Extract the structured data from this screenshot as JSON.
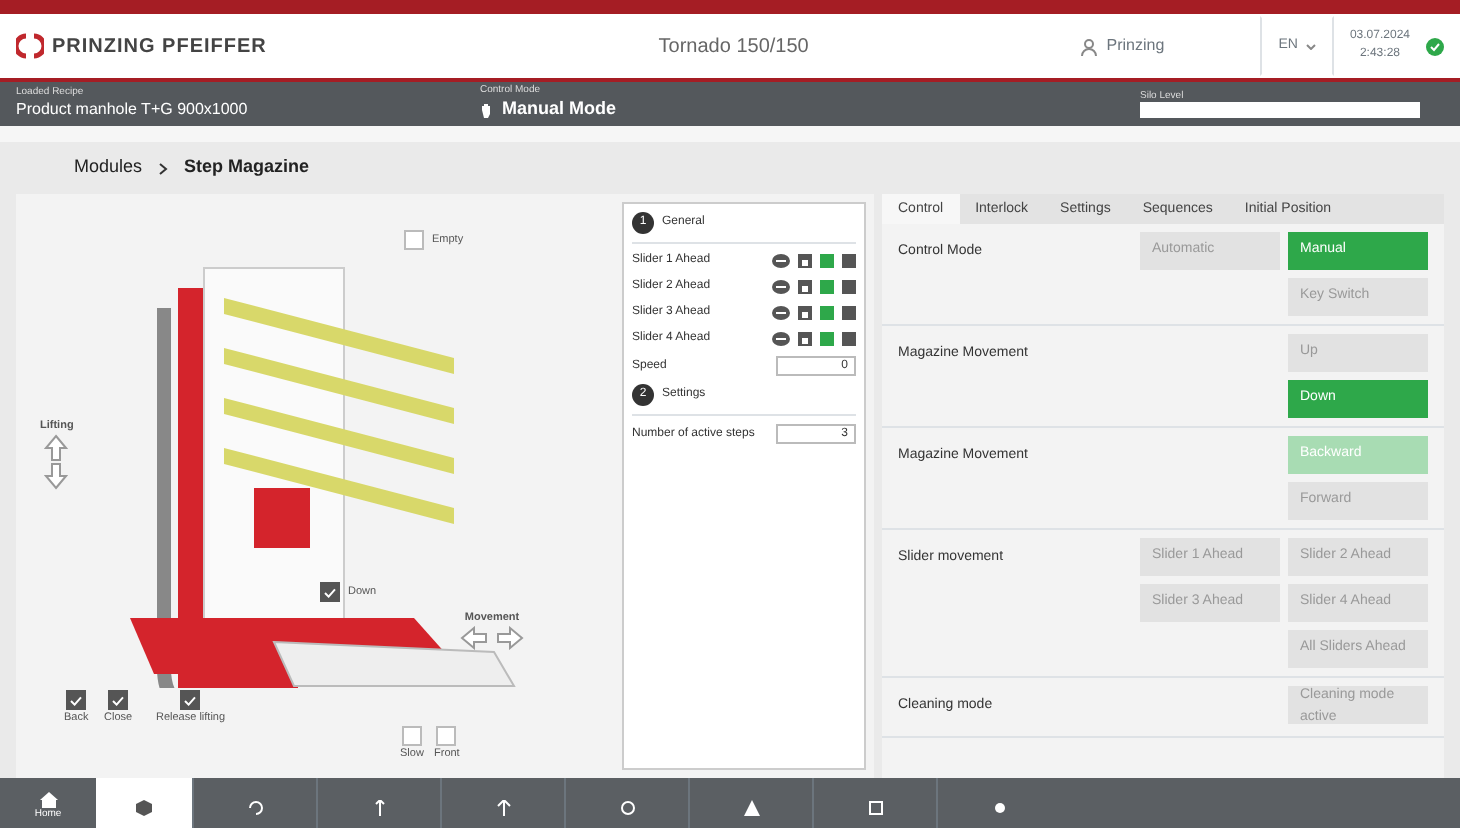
{
  "header": {
    "brand": "PRINZING PFEIFFER",
    "machine": "Tornado 150/150",
    "user": "Prinzing",
    "language": "EN",
    "date": "03.07.2024",
    "time": "2:43:28"
  },
  "info_bar": {
    "recipe_label": "Loaded Recipe",
    "recipe": "Product manhole T+G 900x1000",
    "mode_label": "Control Mode",
    "mode": "Manual Mode",
    "silo_label": "Silo Level"
  },
  "breadcrumb": [
    {
      "label": "Modules"
    },
    {
      "label": "Step Magazine"
    }
  ],
  "diagram": {
    "kind": "picture",
    "lifting_label": "Lifting",
    "movement_label": "Movement",
    "checks": [
      {
        "label": "Empty",
        "checked": false
      },
      {
        "label": "Down",
        "checked": true
      },
      {
        "label": "Back",
        "checked": true
      },
      {
        "label": "Close",
        "checked": true
      },
      {
        "label": "Release lifting",
        "checked": true
      },
      {
        "label": "Slow",
        "checked": false
      },
      {
        "label": "Front",
        "checked": false
      }
    ]
  },
  "general": {
    "number": "1",
    "title": "General",
    "sliders": [
      {
        "label": "Slider 1 Ahead"
      },
      {
        "label": "Slider 2 Ahead"
      },
      {
        "label": "Slider 3 Ahead"
      },
      {
        "label": "Slider 4 Ahead"
      }
    ],
    "speed_label": "Speed",
    "speed": "0"
  },
  "settings": {
    "number": "2",
    "title": "Settings",
    "steps_label": "Number of active steps",
    "steps": "3"
  },
  "tabs": [
    {
      "label": "Control",
      "selected": true
    },
    {
      "label": "Interlock",
      "selected": false
    },
    {
      "label": "Settings",
      "selected": false
    },
    {
      "label": "Sequences",
      "selected": false
    },
    {
      "label": "Initial Position",
      "selected": false
    }
  ],
  "controls": [
    {
      "label": "Control Mode",
      "buttons": [
        {
          "label": "Automatic",
          "selected": false,
          "pending": false
        },
        {
          "label": "Manual",
          "selected": true,
          "pending": false
        },
        {
          "label": "Key Switch",
          "selected": false,
          "pending": false
        }
      ]
    },
    {
      "label": "Magazine Movement",
      "buttons": [
        {
          "label": "Up",
          "selected": false,
          "pending": false
        },
        {
          "label": "Down",
          "selected": true,
          "pending": false
        }
      ]
    },
    {
      "label": "Magazine Movement",
      "buttons": [
        {
          "label": "Backward",
          "selected": false,
          "pending": true
        },
        {
          "label": "Forward",
          "selected": false,
          "pending": false
        }
      ]
    },
    {
      "label": "Slider movement",
      "buttons": [
        {
          "label": "Slider 1 Ahead",
          "selected": false,
          "pending": false
        },
        {
          "label": "Slider 2 Ahead",
          "selected": false,
          "pending": false
        },
        {
          "label": "Slider 3 Ahead",
          "selected": false,
          "pending": false
        },
        {
          "label": "Slider 4 Ahead",
          "selected": false,
          "pending": false
        },
        {
          "label": "All Sliders Ahead",
          "selected": false,
          "pending": false
        }
      ]
    },
    {
      "label": "Cleaning mode",
      "buttons": [
        {
          "label": "Cleaning mode active",
          "selected": false,
          "pending": false
        }
      ]
    }
  ],
  "taskbar": [
    {
      "label": "Home",
      "selected": false
    },
    {
      "selected": true
    }
  ]
}
